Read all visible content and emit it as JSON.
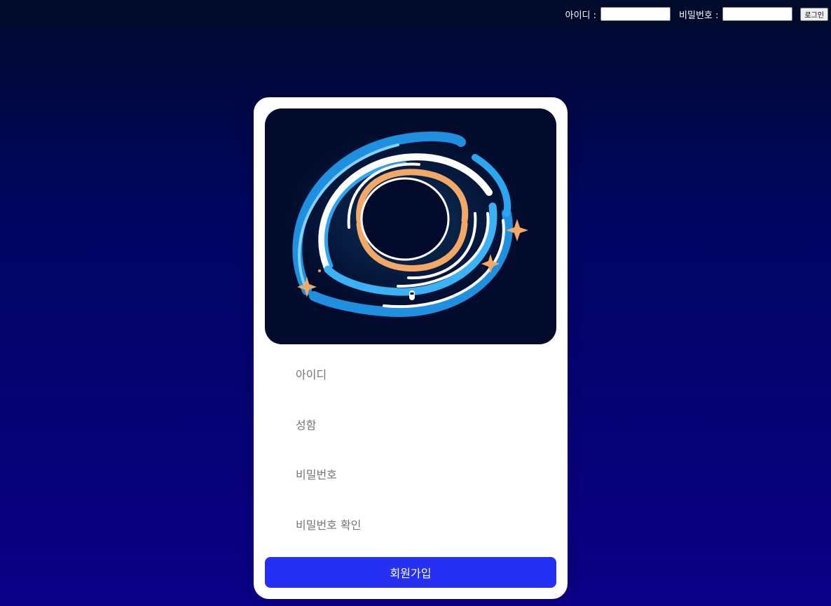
{
  "header": {
    "id_label": "아이디 :",
    "pw_label": "비밀번호 :",
    "id_value": "",
    "pw_value": "",
    "login_button": "로그인"
  },
  "signup_form": {
    "hero_image": "black-hole-illustration",
    "id_placeholder": "아이디",
    "name_placeholder": "성함",
    "password_placeholder": "비밀번호",
    "password_confirm_placeholder": "비밀번호 확인",
    "submit_button": "회원가입"
  },
  "colors": {
    "background_top": "#00092c",
    "background_bottom": "#0c0088",
    "card": "#ffffff",
    "hero_bg": "#020b2b",
    "accent": "#2630f2",
    "swirl_blue": "#2aa7f0",
    "swirl_orange": "#f4a866"
  }
}
